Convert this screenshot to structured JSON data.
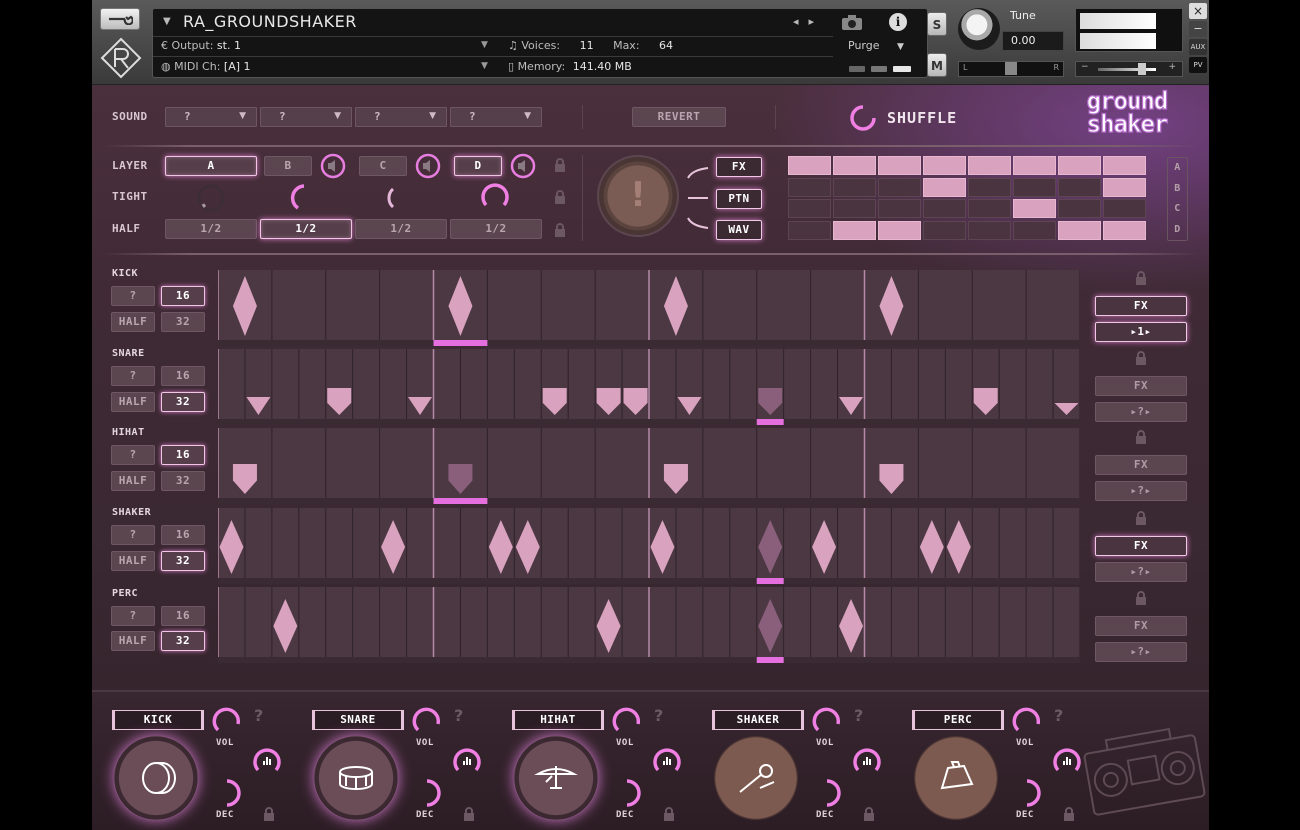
{
  "header": {
    "instrument_name": "RA_GROUNDSHAKER",
    "output_label": "Output:",
    "output_value": "st. 1",
    "voices_label": "Voices:",
    "voices_value": "11",
    "max_label": "Max:",
    "max_value": "64",
    "midi_label": "MIDI Ch:",
    "midi_value": "[A]  1",
    "memory_label": "Memory:",
    "memory_value": "141.40 MB",
    "purge_label": "Purge",
    "solo_label": "S",
    "mute_label": "M",
    "tune_label": "Tune",
    "tune_value": "0.00",
    "pan_left": "L",
    "pan_right": "R",
    "vol_minus": "−",
    "vol_plus": "+",
    "close_label": "×",
    "minimize_label": "−",
    "aux_label": "AUX",
    "pv_label": "PV"
  },
  "sound": {
    "label": "SOUND",
    "dropdowns": [
      "?",
      "?",
      "?",
      "?"
    ],
    "revert_label": "REVERT",
    "shuffle_label": "SHUFFLE",
    "logo_line1": "ground",
    "logo_line2": "shaker"
  },
  "layers": {
    "layer_label": "LAYER",
    "tight_label": "TIGHT",
    "half_label": "HALF",
    "layer_buttons": [
      "A",
      "B",
      "C",
      "D"
    ],
    "half_buttons": [
      "1/2",
      "1/2",
      "1/2",
      "1/2"
    ],
    "mode_buttons": [
      "FX",
      "PTN",
      "WAV"
    ],
    "big_button": "!",
    "abcd": [
      "A",
      "B",
      "C",
      "D"
    ]
  },
  "tracks": [
    {
      "name": "KICK",
      "q": "?",
      "half": "HALF",
      "steps16": "16",
      "steps32": "32",
      "fx": "FX",
      "nav": "▸1▸"
    },
    {
      "name": "SNARE",
      "q": "?",
      "half": "HALF",
      "steps16": "16",
      "steps32": "32",
      "fx": "FX",
      "nav": "▸?▸"
    },
    {
      "name": "HIHAT",
      "q": "?",
      "half": "HALF",
      "steps16": "16",
      "steps32": "32",
      "fx": "FX",
      "nav": "▸?▸"
    },
    {
      "name": "SHAKER",
      "q": "?",
      "half": "HALF",
      "steps16": "16",
      "steps32": "32",
      "fx": "FX",
      "nav": "▸?▸"
    },
    {
      "name": "PERC",
      "q": "?",
      "half": "HALF",
      "steps16": "16",
      "steps32": "32",
      "fx": "FX",
      "nav": "▸?▸"
    }
  ],
  "modules": [
    {
      "name": "KICK",
      "vol": "VOL",
      "dec": "DEC",
      "q": "?"
    },
    {
      "name": "SNARE",
      "vol": "VOL",
      "dec": "DEC",
      "q": "?"
    },
    {
      "name": "HIHAT",
      "vol": "VOL",
      "dec": "DEC",
      "q": "?"
    },
    {
      "name": "SHAKER",
      "vol": "VOL",
      "dec": "DEC",
      "q": "?"
    },
    {
      "name": "PERC",
      "vol": "VOL",
      "dec": "DEC",
      "q": "?"
    }
  ],
  "colors": {
    "accent": "#f0a7e6",
    "note": "#d9a3c0",
    "step_marker": "#e66fe0",
    "panel": "#3f2a35"
  }
}
